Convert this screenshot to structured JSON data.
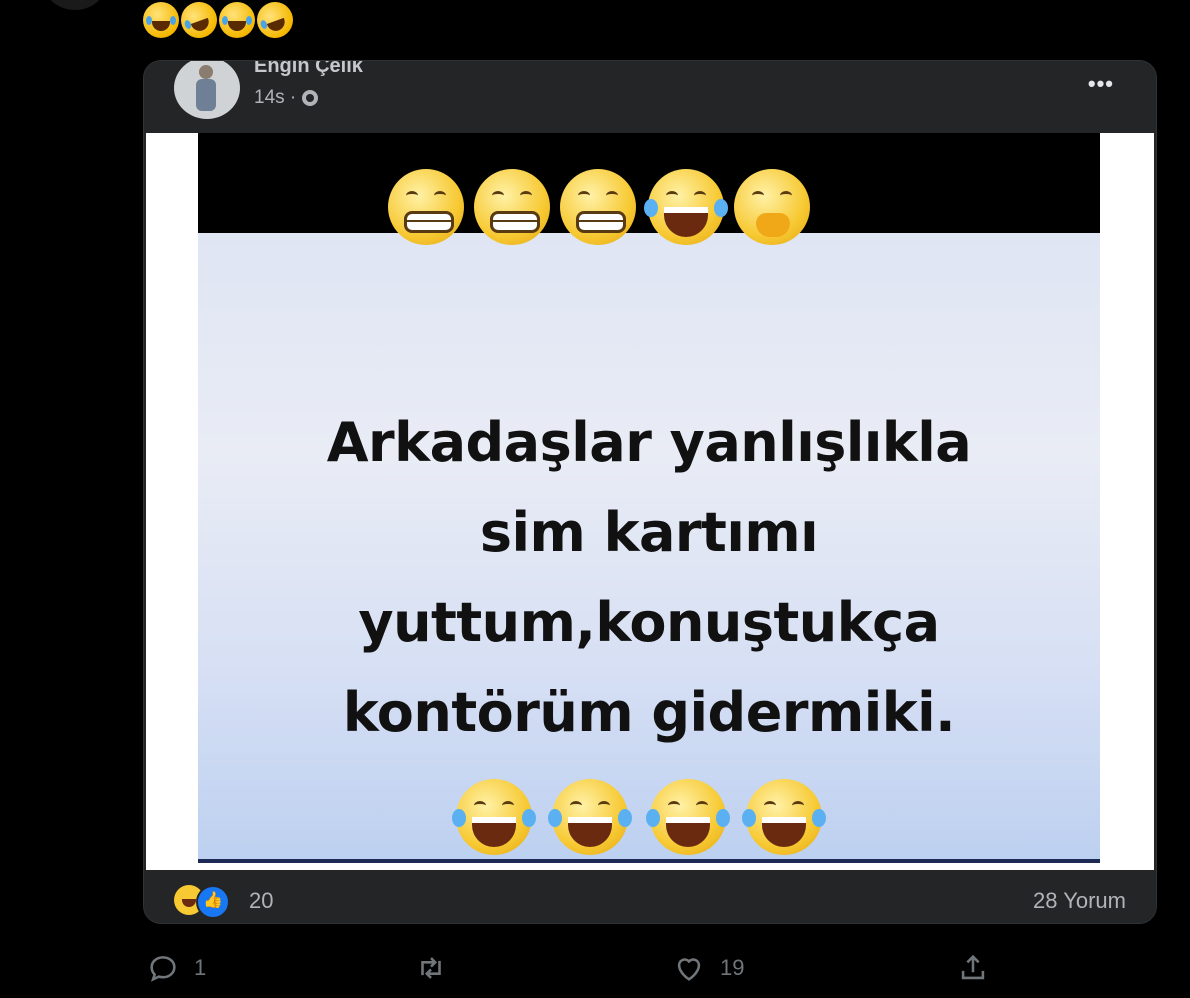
{
  "tweet": {
    "emojis": [
      "face-with-tears-of-joy",
      "rolling-on-floor-laughing",
      "face-with-tears-of-joy",
      "rolling-on-floor-laughing"
    ],
    "actions": {
      "reply_count": "1",
      "retweet_count": "",
      "like_count": "19",
      "share_icon": "share-icon"
    }
  },
  "fb_post": {
    "author": "Engin Çelik",
    "time": "14s ·",
    "more": "•••",
    "image": {
      "top_emojis": [
        "grimacing",
        "grimacing",
        "grimacing",
        "laughing-tears",
        "hand-over-mouth"
      ],
      "lines": [
        "Arkadaşlar yanlışlıkla",
        "sim kartımı",
        "yuttum,konuştukça",
        "kontörüm gidermiki."
      ],
      "bottom_emojis": [
        "laughing-tears",
        "laughing-tears",
        "laughing-tears",
        "laughing-tears"
      ]
    },
    "reactions_count": "20",
    "comments": "28 Yorum"
  },
  "colors": {
    "background": "#000000",
    "card": "#242526",
    "muted": "#71767b",
    "like_blue": "#1877f2"
  }
}
